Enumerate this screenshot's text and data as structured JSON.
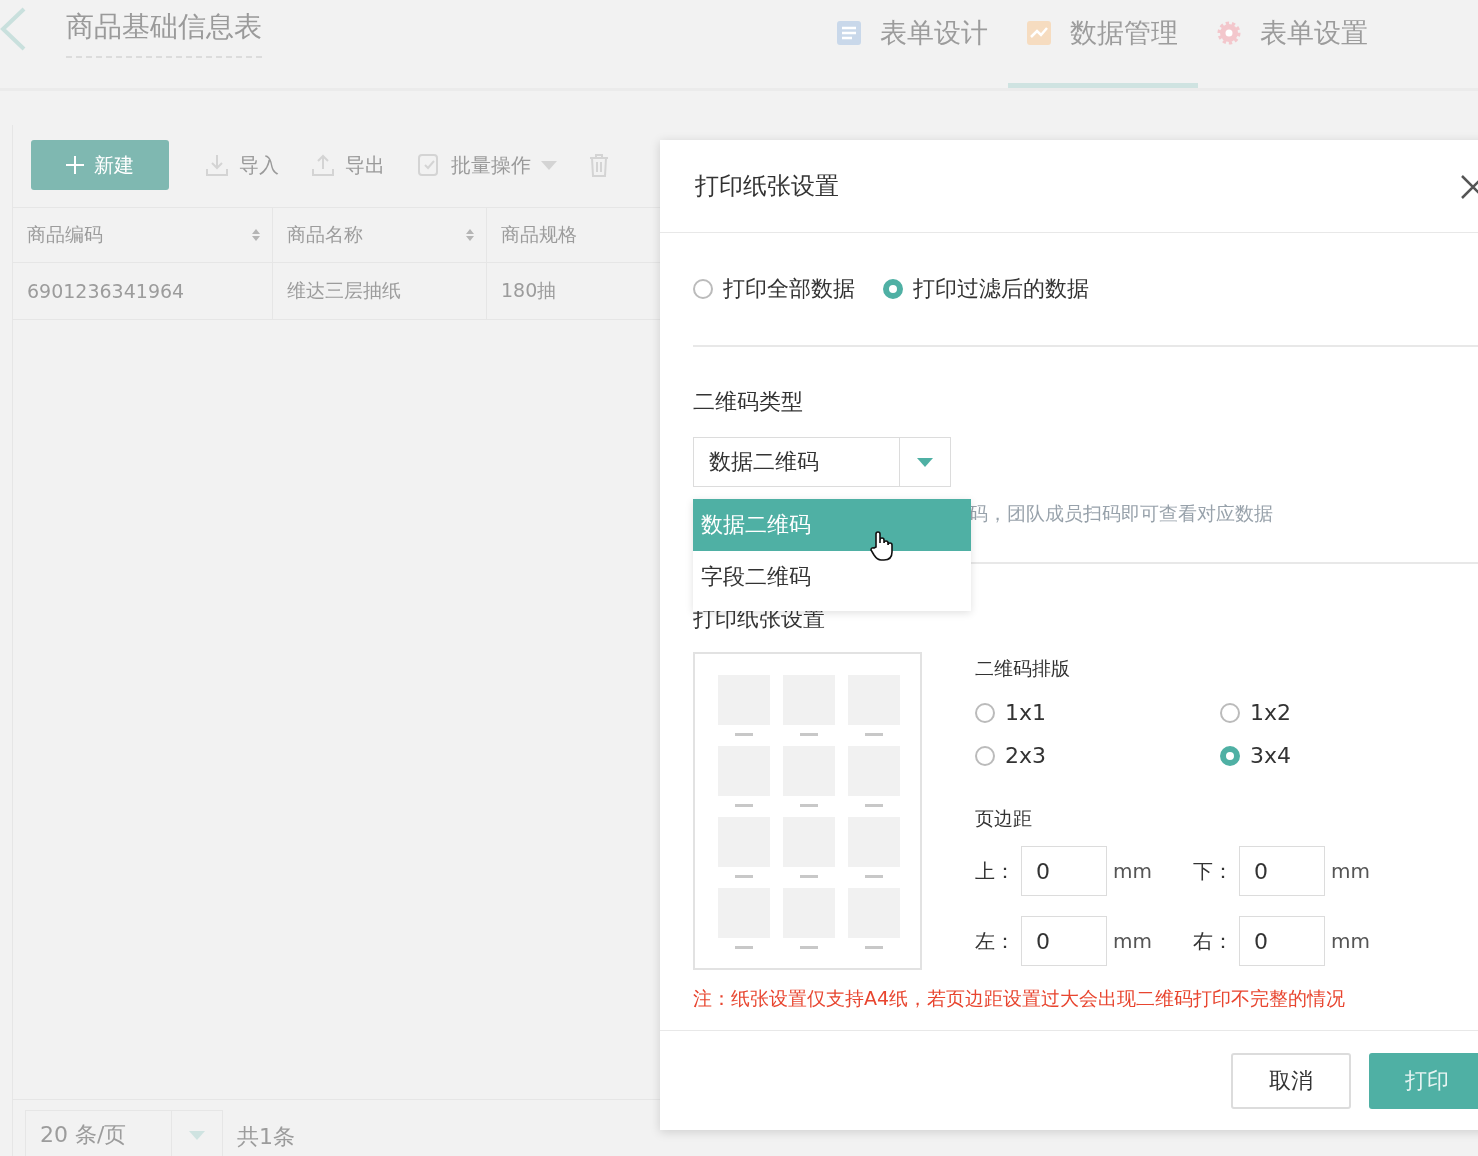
{
  "app_header": {
    "title": "商品基础信息表",
    "tabs": [
      {
        "label": "表单设计",
        "kind": "design",
        "selected": false
      },
      {
        "label": "数据管理",
        "kind": "data",
        "selected": true
      },
      {
        "label": "表单设置",
        "kind": "settings",
        "selected": false
      }
    ]
  },
  "toolbar": [
    {
      "label": "新建",
      "kind": "create"
    },
    {
      "label": "导入",
      "kind": "import"
    },
    {
      "label": "导出",
      "kind": "export"
    },
    {
      "label": "批量操作",
      "kind": "batch"
    },
    {
      "kind": "delete"
    }
  ],
  "table": {
    "columns": [
      {
        "label": "商品编码",
        "sortable": true
      },
      {
        "label": "商品名称",
        "sortable": true
      },
      {
        "label": "商品规格",
        "sortable": false
      }
    ],
    "rows": [
      [
        "6901236341964",
        "维达三层抽纸",
        "180抽"
      ]
    ]
  },
  "pagination": {
    "page_size": "20 条/页",
    "total": "共1条"
  },
  "dialog": {
    "title": "打印纸张设置",
    "scope_options": [
      {
        "label": "打印全部数据",
        "selected": false
      },
      {
        "label": "打印过滤后的数据",
        "selected": true
      }
    ],
    "qr_type": {
      "label": "二维码类型",
      "value": "数据二维码",
      "hint": "码，团队成员扫码即可查看对应数据",
      "options": [
        {
          "label": "数据二维码",
          "selected": true
        },
        {
          "label": "字段二维码",
          "selected": false
        }
      ]
    },
    "paper": {
      "title": "打印纸张设置",
      "layout_label": "二维码排版",
      "layouts": [
        {
          "label": "1x1",
          "selected": false
        },
        {
          "label": "1x2",
          "selected": false
        },
        {
          "label": "2x3",
          "selected": false
        },
        {
          "label": "3x4",
          "selected": true
        }
      ],
      "margin_label": "页边距",
      "margins": [
        {
          "label": "上：",
          "value": "0",
          "unit": "mm"
        },
        {
          "label": "下：",
          "value": "0",
          "unit": "mm"
        },
        {
          "label": "左：",
          "value": "0",
          "unit": "mm"
        },
        {
          "label": "右：",
          "value": "0",
          "unit": "mm"
        }
      ],
      "note": "注：纸张设置仅支持A4纸，若页边距设置过大会出现二维码打印不完整的情况"
    },
    "buttons": [
      {
        "label": "取消",
        "kind": "default"
      },
      {
        "label": "打印",
        "kind": "primary"
      }
    ]
  }
}
